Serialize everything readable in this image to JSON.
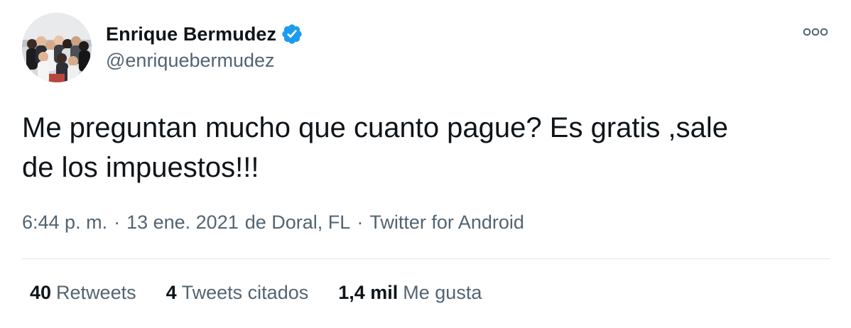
{
  "user": {
    "display_name": "Enrique Bermudez",
    "handle": "@enriquebermudez",
    "verified": true
  },
  "tweet": {
    "text_line1": "Me preguntan mucho que cuanto pague? Es gratis ,sale",
    "text_line2": "de los impuestos!!!"
  },
  "meta": {
    "time": "6:44 p. m.",
    "date": "13 ene. 2021",
    "location": "de Doral, FL",
    "source": "Twitter for Android",
    "separator": "·"
  },
  "stats": [
    {
      "count": "40",
      "label": "Retweets"
    },
    {
      "count": "4",
      "label": "Tweets citados"
    },
    {
      "count": "1,4 mil",
      "label": "Me gusta"
    }
  ],
  "icons": {
    "verified": "verified-badge-icon",
    "more": "more-options-icon"
  },
  "colors": {
    "text_primary": "#0f1419",
    "text_secondary": "#536471",
    "verified_blue": "#1d9bf0",
    "divider": "#e1e8ed"
  }
}
